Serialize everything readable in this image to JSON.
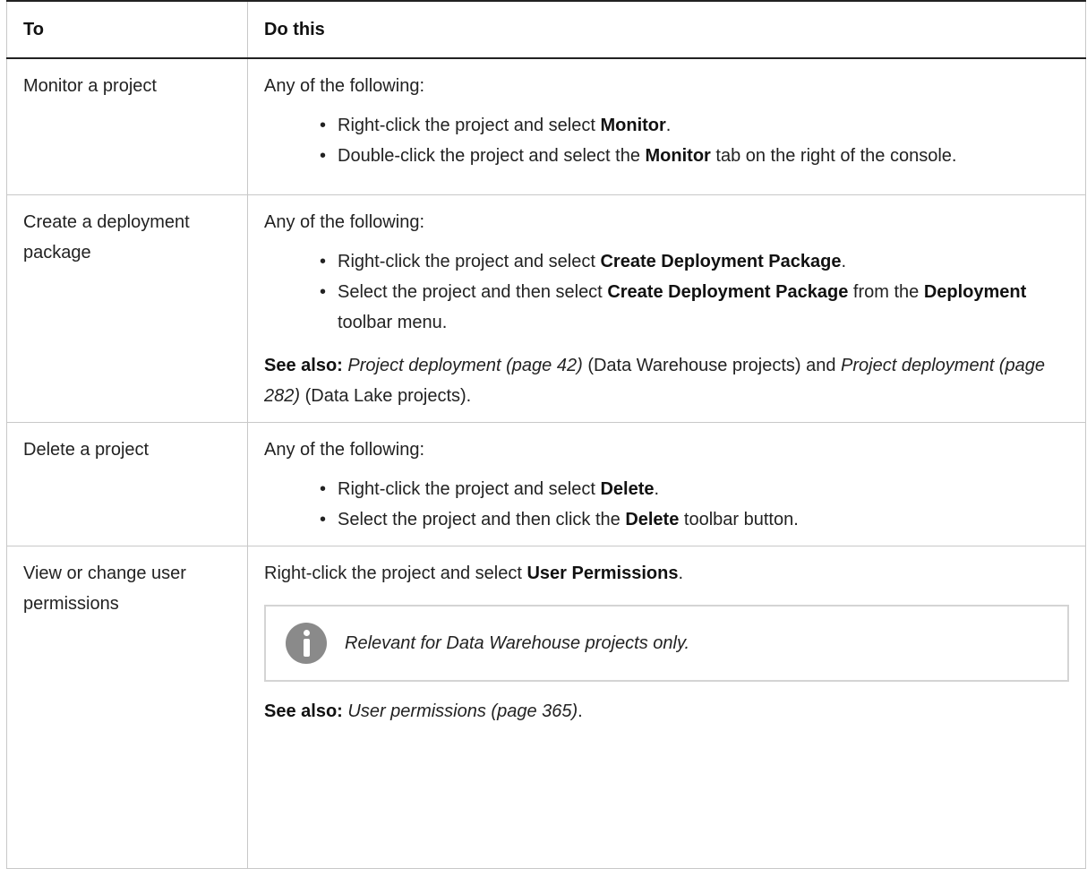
{
  "header": {
    "col_to": "To",
    "col_do": "Do this"
  },
  "rows": [
    {
      "to": "Monitor a project",
      "intro": "Any of the following:",
      "bullets": [
        {
          "pre": "Right-click the project and select ",
          "bold1": "Monitor",
          "mid": ".",
          "bold2": "",
          "post": ""
        },
        {
          "pre": "Double-click the project and select the ",
          "bold1": "Monitor",
          "mid": " tab on the right of the console.",
          "bold2": "",
          "post": ""
        }
      ]
    },
    {
      "to": "Create a deployment package",
      "intro": "Any of the following:",
      "bullets": [
        {
          "pre": "Right-click the project and select ",
          "bold1": "Create Deployment Package",
          "mid": ".",
          "bold2": "",
          "post": ""
        },
        {
          "pre": "Select the project and then select ",
          "bold1": "Create Deployment Package",
          "mid": " from the ",
          "bold2": "Deployment",
          "post": " toolbar menu."
        }
      ],
      "see_also": {
        "label": "See also:",
        "link1": "Project deployment (page 42)",
        "text1": " (Data Warehouse projects) and ",
        "link2": "Project deployment (page 282)",
        "text2": " (Data Lake projects)."
      }
    },
    {
      "to": "Delete a project",
      "intro": "Any of the following:",
      "bullets": [
        {
          "pre": "Right-click the project and select ",
          "bold1": "Delete",
          "mid": ".",
          "bold2": "",
          "post": ""
        },
        {
          "pre": "Select the project and then click the ",
          "bold1": "Delete",
          "mid": " toolbar button.",
          "bold2": "",
          "post": ""
        }
      ]
    },
    {
      "to": "View or change user permissions",
      "line_pre": "Right-click the project and select ",
      "line_bold": "User Permissions",
      "line_post": ".",
      "note": {
        "icon": "info-icon",
        "text": "Relevant for Data Warehouse projects only."
      },
      "see_also": {
        "label": "See also:",
        "link1": "User permissions (page 365)",
        "text1": "."
      }
    }
  ]
}
